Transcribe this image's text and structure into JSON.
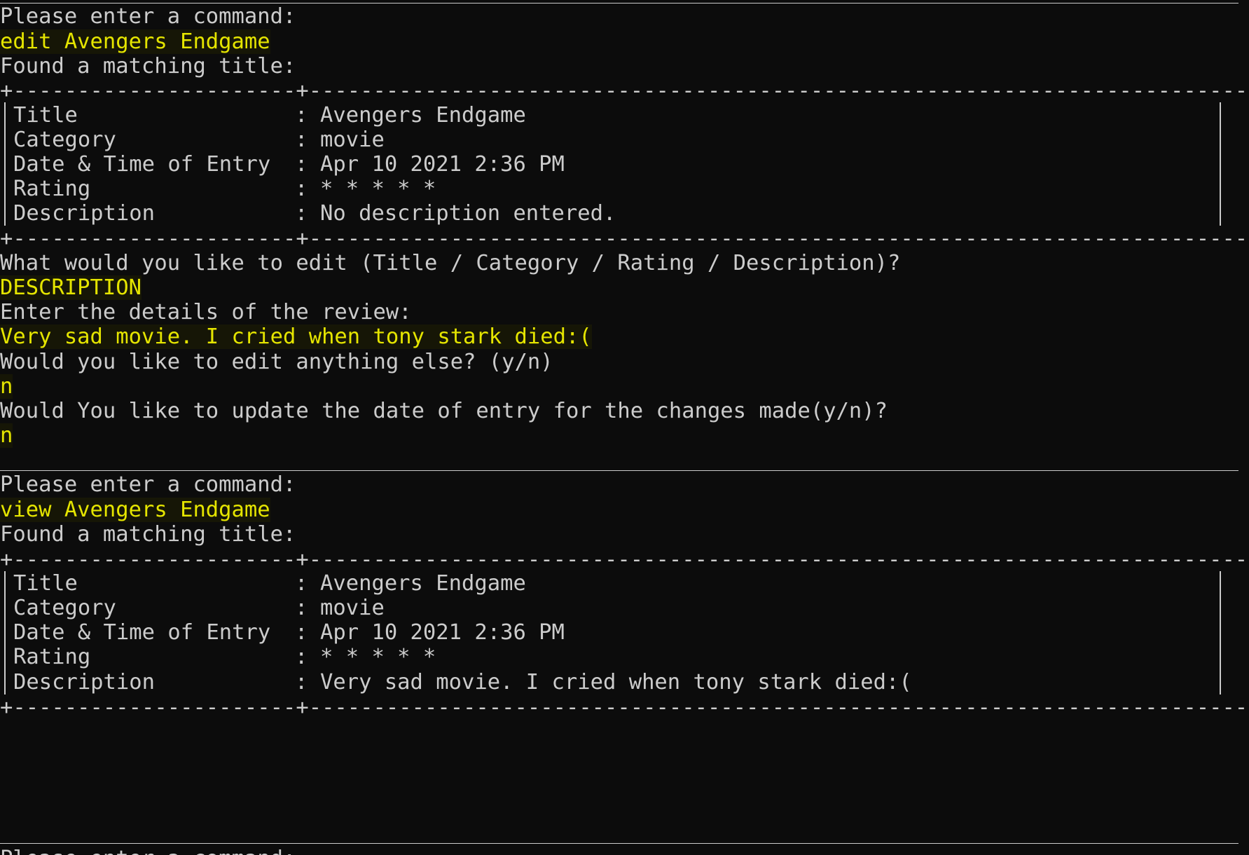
{
  "colors": {
    "background": "#0c0c0c",
    "text": "#cccccc",
    "user_input": "#e5e500"
  },
  "session1": {
    "prompt": "Please enter a command:",
    "command": "edit Avengers Endgame",
    "found": "Found a matching title:",
    "box_border_top": "+----------------------+--------------------------------------------------------------------------+",
    "rows": [
      {
        "label": "Title",
        "value": "Avengers Endgame"
      },
      {
        "label": "Category",
        "value": "movie"
      },
      {
        "label": "Date & Time of Entry",
        "value": "Apr 10 2021 2:36 PM"
      },
      {
        "label": "Rating",
        "value": "* * * * *"
      },
      {
        "label": "Description",
        "value": "No description entered."
      }
    ],
    "box_border_bottom": "+----------------------+--------------------------------------------------------------------------+",
    "edit_question": "What would you like to edit (Title / Category / Rating / Description)?",
    "edit_answer": "DESCRIPTION",
    "details_prompt": "Enter the details of the review:",
    "details_answer": "Very sad movie. I cried when tony stark died:(",
    "more_question": "Would you like to edit anything else? (y/n)",
    "more_answer": "n",
    "date_question": "Would You like to update the date of entry for the changes made(y/n)?",
    "date_answer": "n"
  },
  "session2": {
    "prompt": "Please enter a command:",
    "command": "view Avengers Endgame",
    "found": "Found a matching title:",
    "box_border_top": "+----------------------+--------------------------------------------------------------------------+",
    "rows": [
      {
        "label": "Title",
        "value": "Avengers Endgame"
      },
      {
        "label": "Category",
        "value": "movie"
      },
      {
        "label": "Date & Time of Entry",
        "value": "Apr 10 2021 2:36 PM"
      },
      {
        "label": "Rating",
        "value": "* * * * *"
      },
      {
        "label": "Description",
        "value": "Very sad movie. I cried when tony stark died:("
      }
    ],
    "box_border_bottom": "+----------------------+--------------------------------------------------------------------------+"
  },
  "session3": {
    "prompt": "Please enter a command:"
  }
}
